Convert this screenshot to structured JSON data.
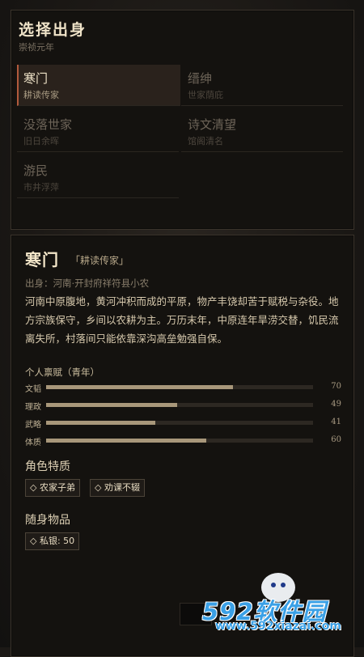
{
  "header": {
    "title": "选择出身",
    "subtitle": "崇祯元年"
  },
  "origins": [
    {
      "name": "寒门",
      "desc": "耕读传家",
      "selected": true
    },
    {
      "name": "缙绅",
      "desc": "世家荫庇",
      "selected": false
    },
    {
      "name": "没落世家",
      "desc": "旧日余晖",
      "selected": false
    },
    {
      "name": "诗文清望",
      "desc": "馆阁清名",
      "selected": false
    },
    {
      "name": "游民",
      "desc": "市井浮萍",
      "selected": false
    }
  ],
  "detail": {
    "name": "寒门",
    "tag": "「耕读传家」",
    "birthplace": "出身：河南·开封府祥符县小农",
    "description": "河南中原腹地，黄河冲积而成的平原，物产丰饶却苦于赋税与杂役。地方宗族保守，乡间以农耕为主。万历末年，中原连年旱涝交替，饥民流离失所，村落间只能依靠深沟高垒勉强自保。",
    "stats_title": "个人禀赋（青年）",
    "stats": [
      {
        "label": "文韬",
        "value": 70
      },
      {
        "label": "理政",
        "value": 49
      },
      {
        "label": "武略",
        "value": 41
      },
      {
        "label": "体质",
        "value": 60
      }
    ],
    "stat_max": 100,
    "traits_title": "角色特质",
    "traits": [
      "◇ 农家子弟",
      "◇ 劝课不辍"
    ],
    "items_title": "随身物品",
    "items": [
      "◇ 私银: 50"
    ]
  },
  "watermark": {
    "brand": "592软件园",
    "url": "www.592xiazai.com"
  },
  "colors": {
    "accent": "#b25a3c",
    "bar_fill": "#a8977a",
    "panel_bg": "#14120f"
  }
}
